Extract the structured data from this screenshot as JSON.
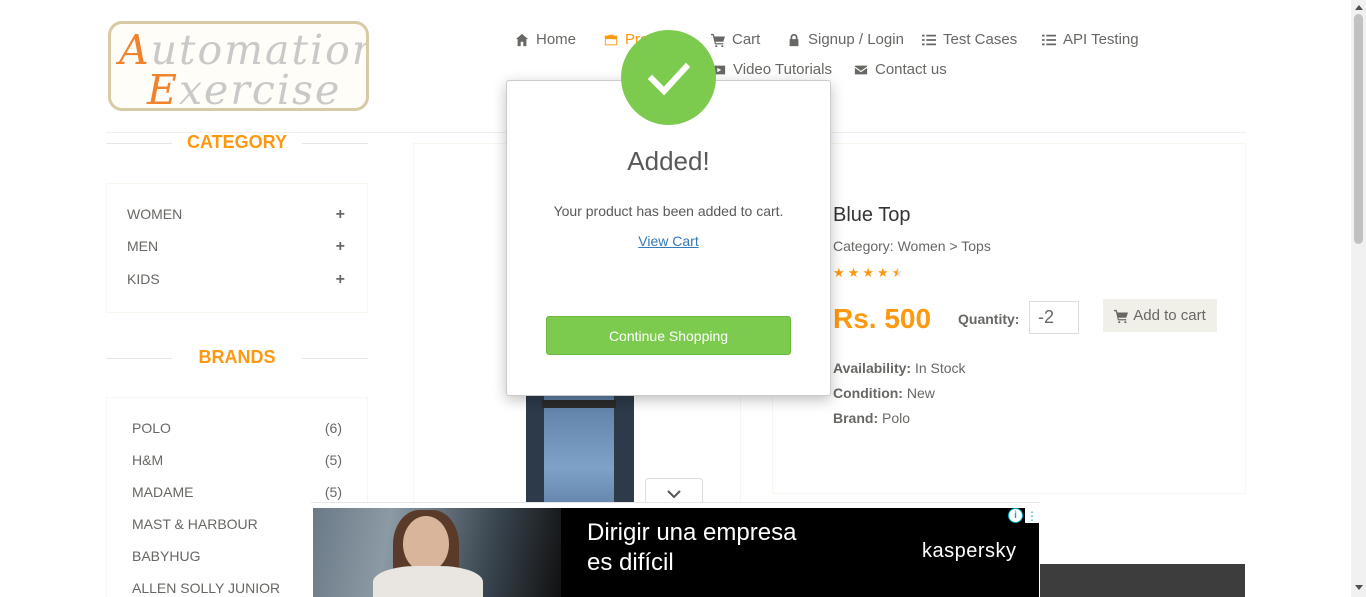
{
  "logo": {
    "line1_cap": "A",
    "line1_rest": "utomation",
    "line2_cap": "E",
    "line2_rest": "xercise"
  },
  "nav": {
    "home": "Home",
    "products": "Products",
    "cart": "Cart",
    "login": "Signup / Login",
    "test_cases": "Test Cases",
    "api_testing": "API Testing",
    "video_tutorials": "Video Tutorials",
    "contact": "Contact us"
  },
  "sidebar": {
    "category_title": "Category",
    "categories": [
      {
        "label": "WOMEN",
        "icon": "plus-icon"
      },
      {
        "label": "MEN",
        "icon": "plus-icon"
      },
      {
        "label": "KIDS",
        "icon": "plus-icon"
      }
    ],
    "brands_title": "Brands",
    "brands": [
      {
        "label": "POLO",
        "count": "(6)"
      },
      {
        "label": "H&M",
        "count": "(5)"
      },
      {
        "label": "MADAME",
        "count": "(5)"
      },
      {
        "label": "MAST & HARBOUR",
        "count": ""
      },
      {
        "label": "BABYHUG",
        "count": ""
      },
      {
        "label": "ALLEN SOLLY JUNIOR",
        "count": ""
      }
    ]
  },
  "product": {
    "name": "Blue Top",
    "category": "Category: Women > Tops",
    "rating": 4.5,
    "price": "Rs. 500",
    "quantity_label": "Quantity:",
    "quantity_value": "-2",
    "add_to_cart": "Add to cart",
    "availability_label": "Availability:",
    "availability": " In Stock",
    "condition_label": "Condition:",
    "condition": " New",
    "brand_label": "Brand:",
    "brand": " Polo"
  },
  "modal": {
    "title": "Added!",
    "message": "Your product has been added to cart.",
    "view_cart": "View Cart",
    "continue": "Continue Shopping",
    "accent": "#7dcb4e"
  },
  "ad": {
    "headline_line1": "Dirigir una empresa",
    "headline_line2": "es difícil",
    "brand": "kaspersky",
    "info": "i",
    "menu": "⋮"
  },
  "colors": {
    "accent": "#fe980f",
    "text": "#696763"
  }
}
